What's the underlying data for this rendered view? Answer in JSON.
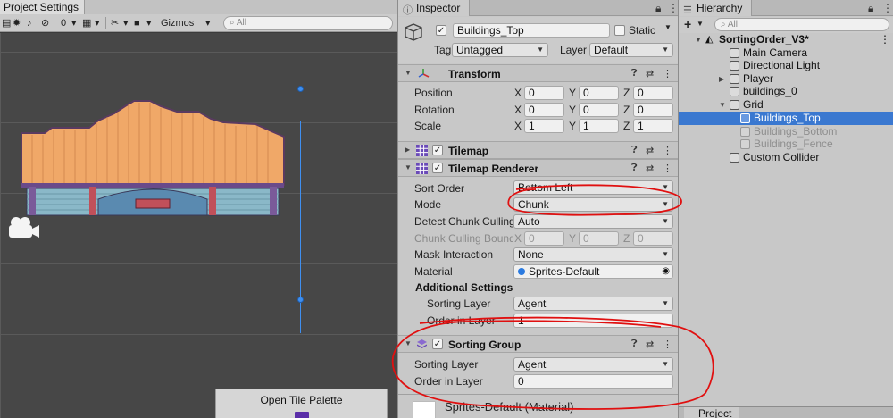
{
  "scene": {
    "tab_title": "Project Settings",
    "toolbar": {
      "gizmo_count": "0",
      "gizmos_label": "Gizmos",
      "search_placeholder": "All"
    },
    "palette_button_label": "Open Tile Palette"
  },
  "inspector": {
    "tab_label": "Inspector",
    "object": {
      "name": "Buildings_Top",
      "active": true,
      "static_label": "Static",
      "tag_label": "Tag",
      "tag_value": "Untagged",
      "layer_label": "Layer",
      "layer_value": "Default"
    },
    "transform": {
      "title": "Transform",
      "rows": [
        {
          "label": "Position",
          "x": "0",
          "y": "0",
          "z": "0"
        },
        {
          "label": "Rotation",
          "x": "0",
          "y": "0",
          "z": "0"
        },
        {
          "label": "Scale",
          "x": "1",
          "y": "1",
          "z": "1"
        }
      ],
      "axis_x": "X",
      "axis_y": "Y",
      "axis_z": "Z"
    },
    "tilemap": {
      "title": "Tilemap",
      "enabled": true
    },
    "tilemap_renderer": {
      "title": "Tilemap Renderer",
      "enabled": true,
      "sort_order_label": "Sort Order",
      "sort_order_value": "Bottom Left",
      "mode_label": "Mode",
      "mode_value": "Chunk",
      "detect_culling_label": "Detect Chunk Culling",
      "detect_culling_value": "Auto",
      "culling_bounds_label": "Chunk Culling Bounds",
      "culling_bounds": {
        "x": "0",
        "y": "0",
        "z": "0"
      },
      "mask_label": "Mask Interaction",
      "mask_value": "None",
      "material_label": "Material",
      "material_value": "Sprites-Default",
      "additional_settings_label": "Additional Settings",
      "sorting_layer_label": "Sorting Layer",
      "sorting_layer_value": "Agent",
      "order_label": "Order in Layer",
      "order_value": "1"
    },
    "sorting_group": {
      "title": "Sorting Group",
      "enabled": true,
      "sorting_layer_label": "Sorting Layer",
      "sorting_layer_value": "Agent",
      "order_label": "Order in Layer",
      "order_value": "0"
    },
    "material_footer": "Sprites-Default (Material)"
  },
  "hierarchy": {
    "tab_label": "Hierarchy",
    "add_label": "+",
    "search_placeholder": "All",
    "scene_name": "SortingOrder_V3*",
    "items": [
      {
        "label": "Main Camera"
      },
      {
        "label": "Directional Light"
      },
      {
        "label": "Player"
      },
      {
        "label": "buildings_0"
      },
      {
        "label": "Grid"
      },
      {
        "label": "Buildings_Top"
      },
      {
        "label": "Buildings_Bottom"
      },
      {
        "label": "Buildings_Fence"
      },
      {
        "label": "Custom Collider"
      }
    ],
    "project_tab_label": "Project"
  },
  "colors": {
    "selection": "#3a78d0",
    "annotation": "#e01010",
    "roof": "#f0a868",
    "wall": "#8ab8c8",
    "pillar": "#c0505a"
  }
}
